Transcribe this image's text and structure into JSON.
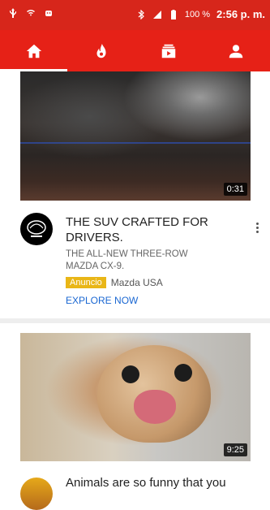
{
  "status_bar": {
    "battery": "100 %",
    "time": "2:56 p. m."
  },
  "nav": {
    "tabs": [
      {
        "icon": "home-icon"
      },
      {
        "icon": "trending-fire-icon"
      },
      {
        "icon": "subscriptions-icon"
      },
      {
        "icon": "account-icon"
      }
    ],
    "active_index": 0
  },
  "feed": {
    "items": [
      {
        "duration": "0:31",
        "title_line1": "THE SUV CRAFTED FOR",
        "title_line2": "DRIVERS.",
        "subtitle_line1": "THE ALL-NEW THREE-ROW",
        "subtitle_line2": "MAZDA CX-9.",
        "badge": "Anuncio",
        "channel": "Mazda USA",
        "cta": "EXPLORE NOW",
        "avatar_brand": "mazda"
      },
      {
        "duration": "9:25",
        "title": "Animals are so funny that you"
      }
    ]
  },
  "colors": {
    "status_bar": "#d7261b",
    "nav_bar": "#e62117",
    "badge": "#e9b617",
    "cta": "#1a67d2"
  }
}
